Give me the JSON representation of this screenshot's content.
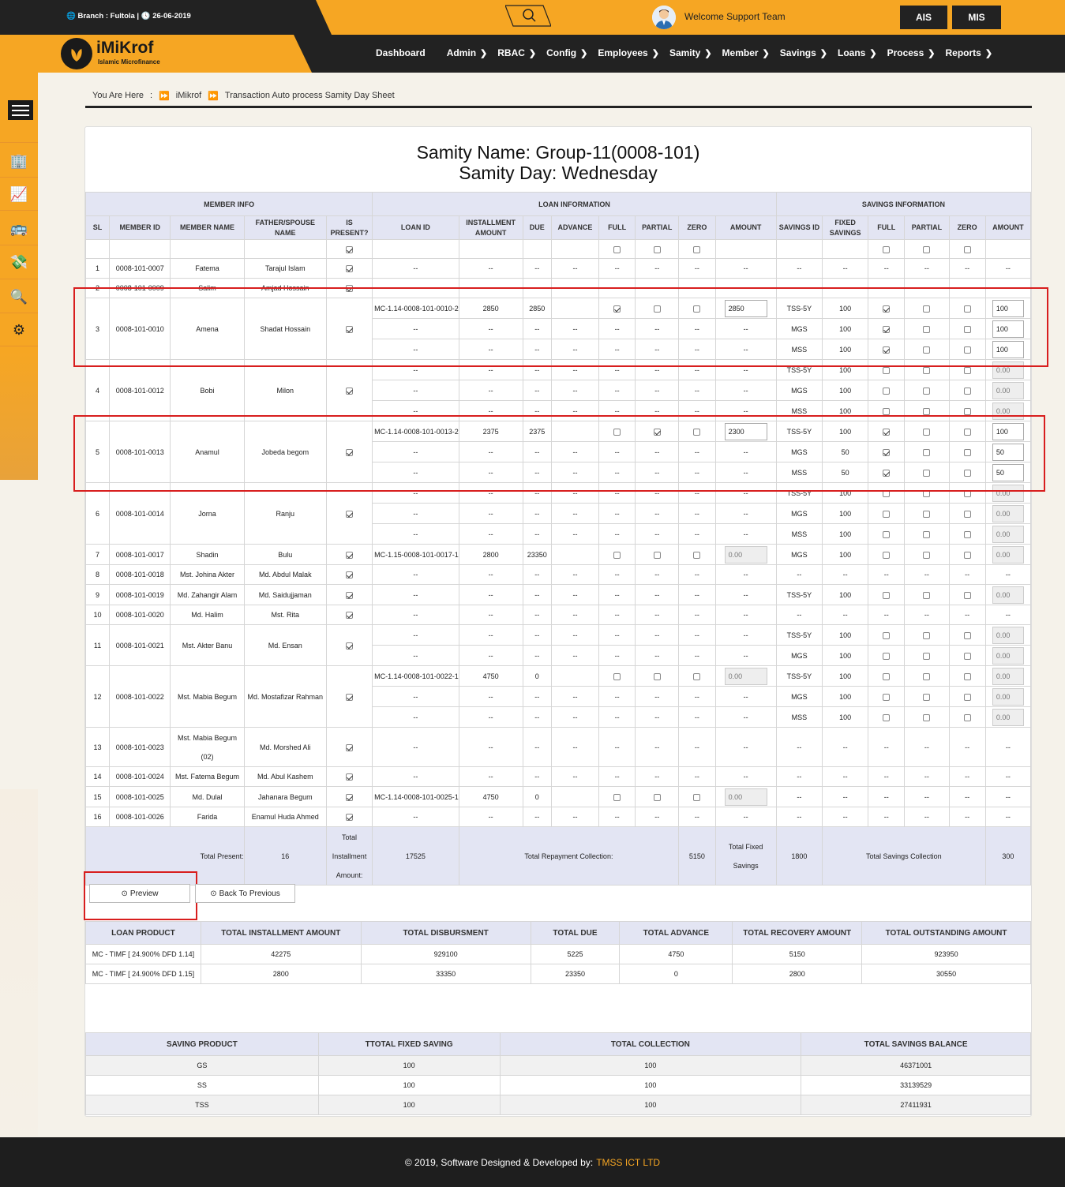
{
  "header": {
    "branch": "Branch : Fultola",
    "date": "26-06-2019",
    "welcome": "Welcome Support Team",
    "ais_label": "AIS",
    "mis_label": "MIS"
  },
  "logo": {
    "name": "iMiKrof",
    "tagline": "Islamic Microfinance"
  },
  "nav": [
    "Dashboard",
    "Admin",
    "RBAC",
    "Config",
    "Employees",
    "Samity",
    "Member",
    "Savings",
    "Loans",
    "Process",
    "Reports"
  ],
  "breadcrumb": {
    "you_are_here": "You Are Here",
    "sep": ":",
    "root": "iMikrof",
    "current": "Transaction Auto process Samity Day Sheet"
  },
  "title": {
    "line1": "Samity Name: Group-11(0008-101)",
    "line2": "Samity Day: Wednesday"
  },
  "table_headers": {
    "group_member": "MEMBER INFO",
    "group_loan": "LOAN INFORMATION",
    "group_savings": "SAVINGS INFORMATION",
    "cols": [
      "SL",
      "MEMBER ID",
      "MEMBER NAME",
      "FATHER/SPOUSE NAME",
      "IS PRESENT?",
      "LOAN ID",
      "INSTALLMENT AMOUNT",
      "DUE",
      "ADVANCE",
      "FULL",
      "PARTIAL",
      "ZERO",
      "AMOUNT",
      "SAVINGS ID",
      "FIXED SAVINGS",
      "FULL",
      "PARTIAL",
      "ZERO",
      "AMOUNT"
    ]
  },
  "rows": [
    {
      "sl": "1",
      "member_id": "0008-101-0007",
      "name": "Fatema",
      "father": "Tarajul Islam",
      "present": true,
      "subs": [
        {
          "loan": null,
          "sav": null
        }
      ]
    },
    {
      "sl": "2",
      "member_id": "0008-101-0009",
      "name": "Salim",
      "father": "Amjad Hossain",
      "present": true,
      "subs": [
        {
          "loan": null,
          "sav": null
        }
      ]
    },
    {
      "sl": "3",
      "member_id": "0008-101-0010",
      "name": "Amena",
      "father": "Shadat Hossain",
      "present": true,
      "subs": [
        {
          "loan": {
            "id": "MC-1.14-0008-101-0010-2",
            "inst": "2850",
            "due": "2850",
            "full": true,
            "partial": false,
            "zero": false,
            "amount": "2850",
            "disabled": false
          },
          "sav": {
            "id": "TSS-5Y",
            "fixed": "100",
            "full": true,
            "amount": "100",
            "disabled": false
          }
        },
        {
          "loan": null,
          "sav": {
            "id": "MGS",
            "fixed": "100",
            "full": true,
            "amount": "100",
            "disabled": false
          }
        },
        {
          "loan": null,
          "sav": {
            "id": "MSS",
            "fixed": "100",
            "full": true,
            "amount": "100",
            "disabled": false
          }
        }
      ]
    },
    {
      "sl": "4",
      "member_id": "0008-101-0012",
      "name": "Bobi",
      "father": "Milon",
      "present": true,
      "subs": [
        {
          "loan": null,
          "sav": {
            "id": "TSS-5Y",
            "fixed": "100",
            "full": false,
            "amount": "0.00",
            "disabled": true
          }
        },
        {
          "loan": null,
          "sav": {
            "id": "MGS",
            "fixed": "100",
            "full": false,
            "amount": "0.00",
            "disabled": true
          }
        },
        {
          "loan": null,
          "sav": {
            "id": "MSS",
            "fixed": "100",
            "full": false,
            "amount": "0.00",
            "disabled": true
          }
        }
      ]
    },
    {
      "sl": "5",
      "member_id": "0008-101-0013",
      "name": "Anamul",
      "father": "Jobeda begom",
      "present": true,
      "subs": [
        {
          "loan": {
            "id": "MC-1.14-0008-101-0013-2",
            "inst": "2375",
            "due": "2375",
            "full": false,
            "partial": true,
            "zero": false,
            "amount": "2300",
            "disabled": false
          },
          "sav": {
            "id": "TSS-5Y",
            "fixed": "100",
            "full": true,
            "amount": "100",
            "disabled": false
          }
        },
        {
          "loan": null,
          "sav": {
            "id": "MGS",
            "fixed": "50",
            "full": true,
            "amount": "50",
            "disabled": false
          }
        },
        {
          "loan": null,
          "sav": {
            "id": "MSS",
            "fixed": "50",
            "full": true,
            "amount": "50",
            "disabled": false
          }
        }
      ]
    },
    {
      "sl": "6",
      "member_id": "0008-101-0014",
      "name": "Jorna",
      "father": "Ranju",
      "present": true,
      "subs": [
        {
          "loan": null,
          "sav": {
            "id": "TSS-5Y",
            "fixed": "100",
            "full": false,
            "amount": "0.00",
            "disabled": true
          }
        },
        {
          "loan": null,
          "sav": {
            "id": "MGS",
            "fixed": "100",
            "full": false,
            "amount": "0.00",
            "disabled": true
          }
        },
        {
          "loan": null,
          "sav": {
            "id": "MSS",
            "fixed": "100",
            "full": false,
            "amount": "0.00",
            "disabled": true
          }
        }
      ]
    },
    {
      "sl": "7",
      "member_id": "0008-101-0017",
      "name": "Shadin",
      "father": "Bulu",
      "present": true,
      "subs": [
        {
          "loan": {
            "id": "MC-1.15-0008-101-0017-1",
            "inst": "2800",
            "due": "23350",
            "full": false,
            "partial": false,
            "zero": false,
            "amount": "0.00",
            "disabled": true
          },
          "sav": {
            "id": "MGS",
            "fixed": "100",
            "full": false,
            "amount": "0.00",
            "disabled": true
          }
        }
      ]
    },
    {
      "sl": "8",
      "member_id": "0008-101-0018",
      "name": "Mst. Johina Akter",
      "father": "Md. Abdul Malak",
      "present": true,
      "subs": [
        {
          "loan": null,
          "sav": null
        }
      ]
    },
    {
      "sl": "9",
      "member_id": "0008-101-0019",
      "name": "Md. Zahangir Alam",
      "father": "Md. Saidujjaman",
      "present": true,
      "subs": [
        {
          "loan": null,
          "sav": {
            "id": "TSS-5Y",
            "fixed": "100",
            "full": false,
            "amount": "0.00",
            "disabled": true
          }
        }
      ]
    },
    {
      "sl": "10",
      "member_id": "0008-101-0020",
      "name": "Md. Halim",
      "father": "Mst. Rita",
      "present": true,
      "subs": [
        {
          "loan": null,
          "sav": null
        }
      ]
    },
    {
      "sl": "11",
      "member_id": "0008-101-0021",
      "name": "Mst. Akter Banu",
      "father": "Md. Ensan",
      "present": true,
      "subs": [
        {
          "loan": null,
          "sav": {
            "id": "TSS-5Y",
            "fixed": "100",
            "full": false,
            "amount": "0.00",
            "disabled": true
          }
        },
        {
          "loan": null,
          "sav": {
            "id": "MGS",
            "fixed": "100",
            "full": false,
            "amount": "0.00",
            "disabled": true
          }
        }
      ]
    },
    {
      "sl": "12",
      "member_id": "0008-101-0022",
      "name": "Mst. Mabia Begum",
      "father": "Md. Mostafizar Rahman",
      "present": true,
      "subs": [
        {
          "loan": {
            "id": "MC-1.14-0008-101-0022-1",
            "inst": "4750",
            "due": "0",
            "full": false,
            "partial": false,
            "zero": false,
            "amount": "0.00",
            "disabled": true
          },
          "sav": {
            "id": "TSS-5Y",
            "fixed": "100",
            "full": false,
            "amount": "0.00",
            "disabled": true
          }
        },
        {
          "loan": null,
          "sav": {
            "id": "MGS",
            "fixed": "100",
            "full": false,
            "amount": "0.00",
            "disabled": true
          }
        },
        {
          "loan": null,
          "sav": {
            "id": "MSS",
            "fixed": "100",
            "full": false,
            "amount": "0.00",
            "disabled": true
          }
        }
      ]
    },
    {
      "sl": "13",
      "member_id": "0008-101-0023",
      "name": "Mst. Mabia Begum (02)",
      "father": "Md. Morshed Ali",
      "present": true,
      "tall": true,
      "subs": [
        {
          "loan": null,
          "sav": null
        }
      ]
    },
    {
      "sl": "14",
      "member_id": "0008-101-0024",
      "name": "Mst. Fatema Begum",
      "father": "Md. Abul Kashem",
      "present": true,
      "subs": [
        {
          "loan": null,
          "sav": null
        }
      ]
    },
    {
      "sl": "15",
      "member_id": "0008-101-0025",
      "name": "Md. Dulal",
      "father": "Jahanara Begum",
      "present": true,
      "subs": [
        {
          "loan": {
            "id": "MC-1.14-0008-101-0025-1",
            "inst": "4750",
            "due": "0",
            "full": false,
            "partial": false,
            "zero": false,
            "amount": "0.00",
            "disabled": true
          },
          "sav": null
        }
      ]
    },
    {
      "sl": "16",
      "member_id": "0008-101-0026",
      "name": "Farida",
      "father": "Enamul Huda Ahmed",
      "present": true,
      "subs": [
        {
          "loan": null,
          "sav": null
        }
      ]
    }
  ],
  "dash": "--",
  "totals": {
    "present_label": "Total Present:",
    "present": "16",
    "inst_label": "Total Installment Amount:",
    "inst": "17525",
    "repay_label": "Total Repayment Collection:",
    "repay": "5150",
    "fixed_label": "Total Fixed Savings",
    "fixed": "1800",
    "savcoll_label": "Total Savings Collection",
    "savcoll": "300"
  },
  "buttons": {
    "preview": "Preview",
    "back": "Back To Previous"
  },
  "loan_summary": {
    "headers": [
      "LOAN PRODUCT",
      "TOTAL INSTALLMENT AMOUNT",
      "TOTAL DISBURSMENT",
      "TOTAL DUE",
      "TOTAL ADVANCE",
      "TOTAL RECOVERY AMOUNT",
      "TOTAL OUTSTANDING AMOUNT"
    ],
    "rows": [
      [
        "MC - TIMF [ 24.900% DFD 1.14]",
        "42275",
        "929100",
        "5225",
        "4750",
        "5150",
        "923950"
      ],
      [
        "MC - TIMF [ 24.900% DFD 1.15]",
        "2800",
        "33350",
        "23350",
        "0",
        "2800",
        "30550"
      ]
    ]
  },
  "saving_summary": {
    "headers": [
      "SAVING PRODUCT",
      "TTOTAL FIXED SAVING",
      "TOTAL COLLECTION",
      "TOTAL SAVINGS BALANCE"
    ],
    "rows": [
      [
        "GS",
        "100",
        "100",
        "46371001"
      ],
      [
        "SS",
        "100",
        "100",
        "33139529"
      ],
      [
        "TSS",
        "100",
        "100",
        "27411931"
      ]
    ]
  },
  "footer": {
    "text": "© 2019, Software Designed & Developed by:",
    "brand": "TMSS ICT LTD"
  },
  "colors": {
    "accent": "#f6a623",
    "dark": "#222222",
    "header_bg": "#e3e5f3",
    "highlight": "#d81e1e"
  }
}
